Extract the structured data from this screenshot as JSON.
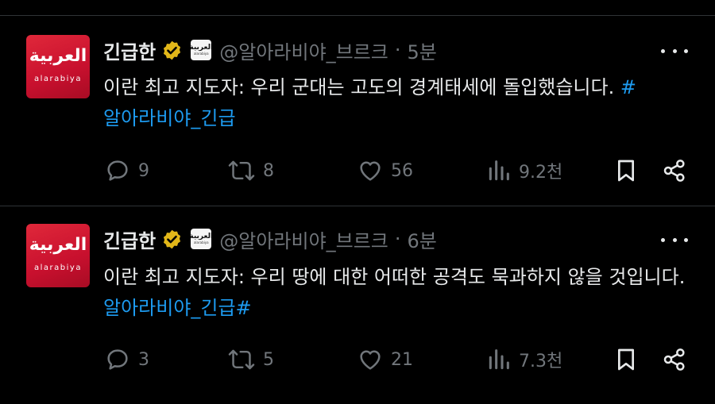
{
  "tweets": [
    {
      "avatar": {
        "arabic": "العربية",
        "latin": "alarabiya"
      },
      "author_name": "긴급한",
      "handle": "@알아라비야_브르크",
      "separator": "·",
      "time": "5분",
      "text_plain": "이란 최고 지도자: 우리 군대는 고도의 경계태세에 돌입했습니다. ",
      "text_link": "#\n알아라비야_긴급",
      "replies": "9",
      "retweets": "8",
      "likes": "56",
      "views": "9.2천"
    },
    {
      "avatar": {
        "arabic": "العربية",
        "latin": "alarabiya"
      },
      "author_name": "긴급한",
      "handle": "@알아라비야_브르크",
      "separator": "·",
      "time": "6분",
      "text_plain": "이란 최고 지도자: 우리 땅에 대한 어떠한 공격도 묵과하지 않을 것입니다. ",
      "text_link": "알아라비야_긴급#",
      "replies": "3",
      "retweets": "5",
      "likes": "21",
      "views": "7.3천"
    }
  ],
  "colors": {
    "background": "#000000",
    "text": "#e7e9ea",
    "muted": "#71767b",
    "link": "#1d9bf0",
    "verified_gold": "#e2b719",
    "divider": "#2f3336",
    "avatar_red": "#c8102e"
  },
  "icons": [
    "verified-badge-icon",
    "affiliate-badge-icon",
    "more-icon",
    "reply-icon",
    "retweet-icon",
    "like-icon",
    "views-icon",
    "bookmark-icon",
    "share-icon"
  ]
}
